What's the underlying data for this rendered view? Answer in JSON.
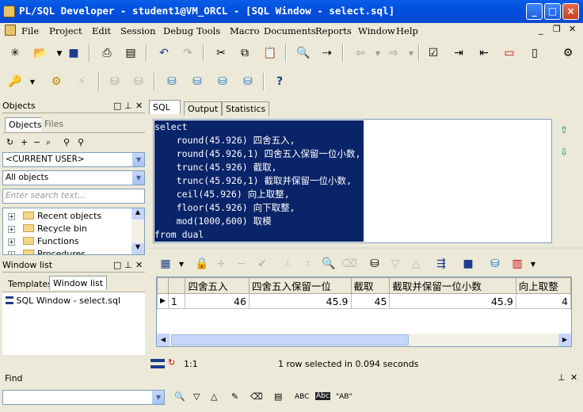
{
  "window": {
    "title": "PL/SQL Developer - student1@VM_ORCL - [SQL Window - select.sql]",
    "buttons": [
      "_",
      "□",
      "×"
    ]
  },
  "menu": [
    "File",
    "Project",
    "Edit",
    "Session",
    "Debug",
    "Tools",
    "Macro",
    "Documents",
    "Reports",
    "Window",
    "Help"
  ],
  "objects_panel": {
    "title": "Objects",
    "tabs": [
      "Objects",
      "Files"
    ],
    "user_combo": "<CURRENT USER>",
    "filter_combo": "All objects",
    "search_placeholder": "Enter search text...",
    "tree": [
      "Recent objects",
      "Recycle bin",
      "Functions",
      "Procedures"
    ]
  },
  "window_list_panel": {
    "title": "Window list",
    "tabs": [
      "Templates",
      "Window list"
    ],
    "items": [
      "SQL Window - select.sql"
    ]
  },
  "editor_tabs": [
    "SQL",
    "Output",
    "Statistics"
  ],
  "code_lines": [
    "select",
    "    round(45.926) 四舍五入,",
    "    round(45.926,1) 四舍五入保留一位小数,",
    "    trunc(45.926) 截取,",
    "    trunc(45.926,1) 截取并保留一位小数,",
    "    ceil(45.926) 向上取整,",
    "    floor(45.926) 向下取整,",
    "    mod(1000,600) 取模",
    "from dual"
  ],
  "grid": {
    "columns": [
      "四舍五入",
      "四舍五入保留一位",
      "截取",
      "截取并保留一位小数",
      "向上取整"
    ],
    "rows": [
      [
        "1",
        "46",
        "45.9",
        "45",
        "45.9",
        "4"
      ]
    ]
  },
  "status": {
    "position": "1:1",
    "message": "1 row selected in 0.094 seconds"
  },
  "find": {
    "label": "Find",
    "toggles": [
      "ABC",
      "Abc",
      "\"AB\""
    ]
  }
}
